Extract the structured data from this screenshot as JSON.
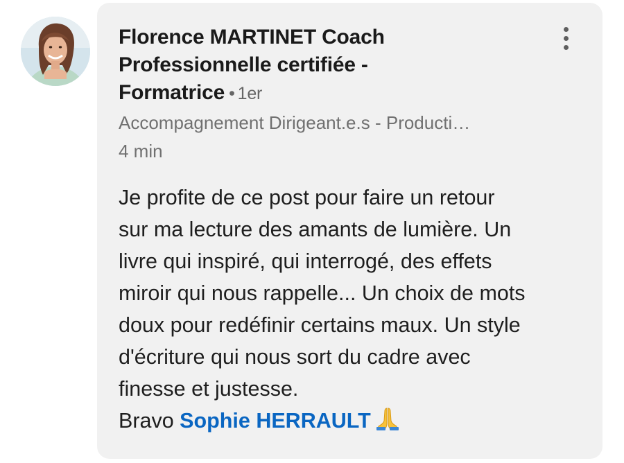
{
  "comment": {
    "author": {
      "name": "Florence MARTINET Coach Professionnelle certifiée - Formatrice",
      "name_lines": [
        "Florence MARTINET Coach",
        "Professionnelle certifiée -",
        "Formatrice"
      ],
      "degree_separator": "•",
      "degree": "1er",
      "headline": "Accompagnement Dirigeant.e.s - Producti…",
      "avatar_icon": "profile-photo"
    },
    "timestamp": "4 min",
    "more_icon": "vertical-ellipsis-icon",
    "body_lines": [
      "Je profite de ce post pour faire un retour",
      "sur ma lecture des amants de lumière. Un",
      "livre qui inspiré, qui interrogé, des effets",
      "miroir qui nous rappelle... Un choix de mots",
      "doux pour redéfinir certains maux. Un style",
      "d'écriture qui nous sort du cadre avec",
      "finesse et justesse."
    ],
    "closing": {
      "prefix": "Bravo",
      "mention": "Sophie HERRAULT",
      "emoji": "folded-hands-icon"
    }
  },
  "colors": {
    "bubble_bg": "#f1f1f1",
    "mention": "#0a66c2",
    "secondary_text": "#707070"
  }
}
